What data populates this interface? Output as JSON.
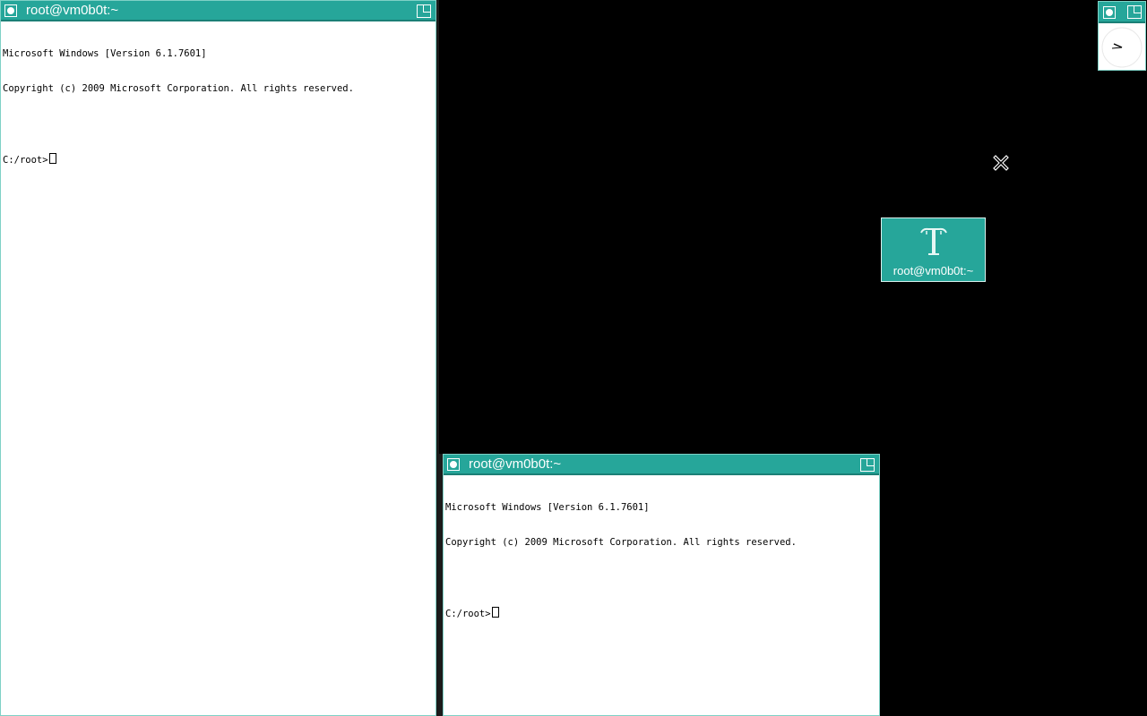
{
  "desktop": {
    "background": "#000000",
    "accent": "#26a69a"
  },
  "terminals": [
    {
      "title": "root@vm0b0t:~",
      "lines": [
        "Microsoft Windows [Version 6.1.7601]",
        "Copyright (c) 2009 Microsoft Corporation. All rights reserved.",
        "",
        "C:/root>"
      ]
    },
    {
      "title": "root@vm0b0t:~",
      "lines": [
        "Microsoft Windows [Version 6.1.7601]",
        "Copyright (c) 2009 Microsoft Corporation. All rights reserved.",
        "",
        "C:/root>"
      ]
    }
  ],
  "iconified_window": {
    "label": "root@vm0b0t:~",
    "icon": "terminal-icon"
  },
  "clock": {
    "icon": "clock-icon"
  },
  "pointer": {
    "icon": "x-cursor-icon"
  }
}
